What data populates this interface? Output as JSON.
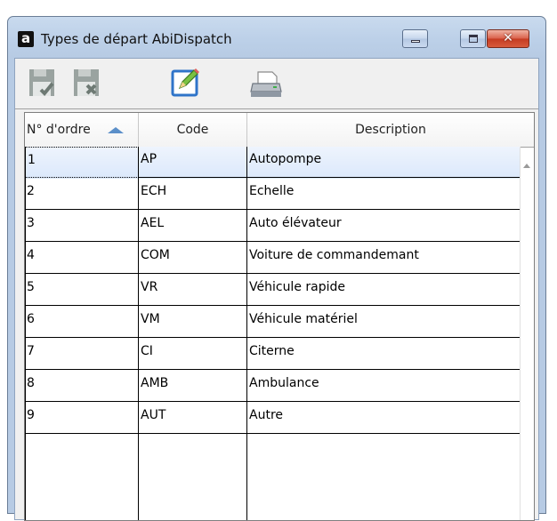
{
  "window": {
    "app_icon_glyph": "a",
    "title": "Types de départ AbiDispatch",
    "close_glyph": "✕"
  },
  "toolbar": {
    "items": [
      {
        "icon": "save-check-icon"
      },
      {
        "icon": "save-cancel-icon"
      },
      {
        "icon": "edit-icon"
      },
      {
        "icon": "print-icon"
      }
    ]
  },
  "grid": {
    "columns": [
      "N° d'ordre",
      "Code",
      "Description"
    ],
    "sort_column": 0,
    "rows": [
      {
        "num": "1",
        "code": "AP",
        "description": "Autopompe"
      },
      {
        "num": "2",
        "code": "ECH",
        "description": "Echelle"
      },
      {
        "num": "3",
        "code": "AEL",
        "description": "Auto élévateur"
      },
      {
        "num": "4",
        "code": "COM",
        "description": "Voiture de commandemant"
      },
      {
        "num": "5",
        "code": "VR",
        "description": "Véhicule rapide"
      },
      {
        "num": "6",
        "code": "VM",
        "description": "Véhicule matériel"
      },
      {
        "num": "7",
        "code": "CI",
        "description": "Citerne"
      },
      {
        "num": "8",
        "code": "AMB",
        "description": "Ambulance"
      },
      {
        "num": "9",
        "code": "AUT",
        "description": "Autre"
      }
    ]
  },
  "colors": {
    "selection": "#dbe8fb",
    "sort_arrow": "#5b8fc9",
    "close_button": "#c43b22"
  }
}
